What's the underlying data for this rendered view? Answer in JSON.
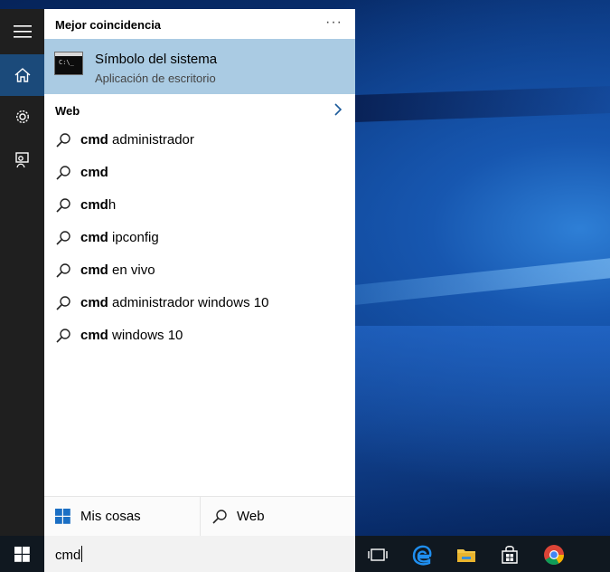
{
  "best_match": {
    "heading": "Mejor coincidencia",
    "more_glyph": "···",
    "title": "Símbolo del sistema",
    "subtitle": "Aplicación de escritorio",
    "icon_prompt": "C:\\_"
  },
  "web": {
    "heading": "Web",
    "suggestions": [
      {
        "bold": "cmd",
        "rest": " administrador"
      },
      {
        "bold": "cmd",
        "rest": ""
      },
      {
        "bold": "cmd",
        "rest": "h"
      },
      {
        "bold": "cmd",
        "rest": " ipconfig"
      },
      {
        "bold": "cmd",
        "rest": " en vivo"
      },
      {
        "bold": "cmd",
        "rest": " administrador windows 10"
      },
      {
        "bold": "cmd",
        "rest": " windows 10"
      }
    ]
  },
  "bottom_tabs": {
    "my_stuff": "Mis cosas",
    "web": "Web"
  },
  "search": {
    "value": "cmd"
  },
  "colors": {
    "accent": "#1b4a7a",
    "highlight": "#aacbe3",
    "rail": "#1f1f1f",
    "taskbar": "#101820"
  }
}
